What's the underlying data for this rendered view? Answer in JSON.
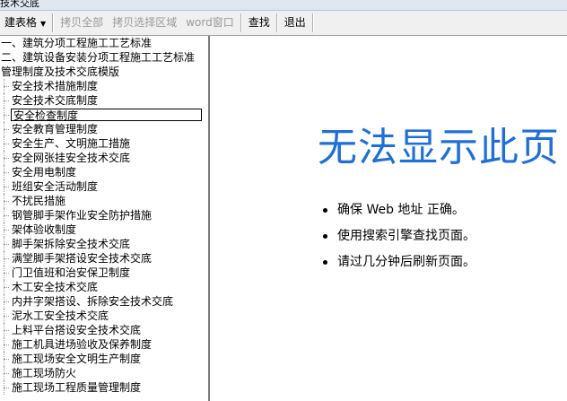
{
  "window": {
    "title": "技术交底"
  },
  "toolbar": {
    "create_table": "建表格",
    "copy_all": "拷贝全部",
    "copy_selection": "拷贝选择区域",
    "word_window": "word窗口",
    "find": "查找",
    "exit": "退出"
  },
  "tree": {
    "items": [
      {
        "label": "一、建筑分项工程施工工艺标准",
        "level": 0
      },
      {
        "label": "二、建筑设备安装分项工程施工工艺标准",
        "level": 0
      },
      {
        "label": "管理制度及技术交底模版",
        "level": 0
      },
      {
        "label": "安全技术措施制度",
        "level": 1
      },
      {
        "label": "安全技术交底制度",
        "level": 1
      },
      {
        "label": "安全检查制度",
        "level": 1,
        "selected": true
      },
      {
        "label": "安全教育管理制度",
        "level": 1
      },
      {
        "label": "安全生产、文明施工措施",
        "level": 1
      },
      {
        "label": "安全网张挂安全技术交底",
        "level": 1
      },
      {
        "label": "安全用电制度",
        "level": 1
      },
      {
        "label": "班组安全活动制度",
        "level": 1
      },
      {
        "label": "不扰民措施",
        "level": 1
      },
      {
        "label": "钢管脚手架作业安全防护措施",
        "level": 1
      },
      {
        "label": "架体验收制度",
        "level": 1
      },
      {
        "label": "脚手架拆除安全技术交底",
        "level": 1
      },
      {
        "label": "满堂脚手架搭设安全技术交底",
        "level": 1
      },
      {
        "label": "门卫值班和治安保卫制度",
        "level": 1
      },
      {
        "label": "木工安全技术交底",
        "level": 1
      },
      {
        "label": "内井字架搭设、拆除安全技术交底",
        "level": 1
      },
      {
        "label": "泥水工安全技术交底",
        "level": 1
      },
      {
        "label": "上料平台搭设安全技术交底",
        "level": 1
      },
      {
        "label": "施工机具进场验收及保养制度",
        "level": 1
      },
      {
        "label": "施工现场安全文明生产制度",
        "level": 1
      },
      {
        "label": "施工现场防火",
        "level": 1
      },
      {
        "label": "施工现场工程质量管理制度",
        "level": 1
      }
    ]
  },
  "content": {
    "error_title": "无法显示此页",
    "bullets": [
      "确保 Web 地址  正确。",
      "使用搜索引擎查找页面。",
      "请过几分钟后刷新页面。"
    ]
  }
}
